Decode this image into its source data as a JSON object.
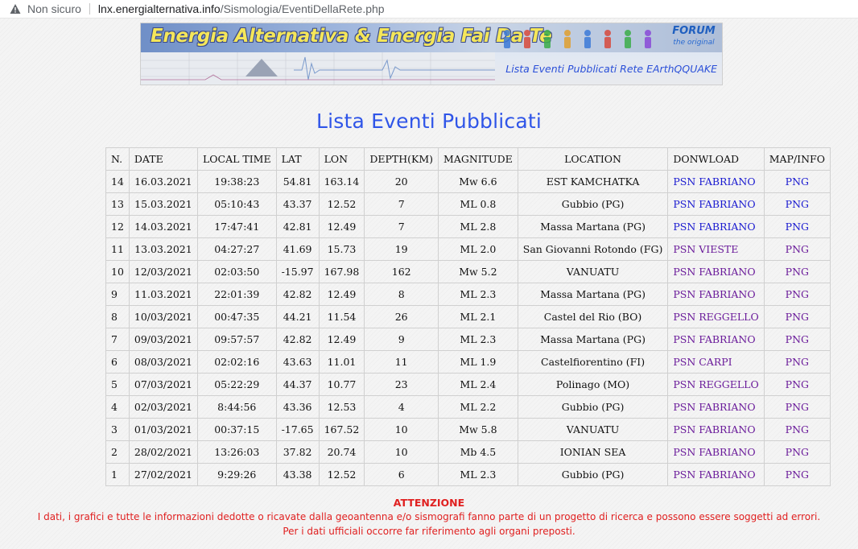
{
  "browser": {
    "security_label": "Non sicuro",
    "url_host": "lnx.energialternativa.info",
    "url_path": "/Sismologia/EventiDellaRete.php"
  },
  "banner": {
    "title": "Energia Alternativa & Energia Fai Da Te",
    "forum_label": "FORUM",
    "forum_sub": "the original",
    "subtitle": "Lista Eventi Pubblicati Rete EArthQQUAKE"
  },
  "page_title": "Lista Eventi Pubblicati",
  "table": {
    "headers": [
      "N.",
      "DATE",
      "LOCAL TIME",
      "LAT",
      "LON",
      "DEPTH(KM)",
      "MAGNITUDE",
      "LOCATION",
      "DONWLOAD",
      "MAP/INFO"
    ],
    "rows": [
      {
        "n": "14",
        "date": "16.03.2021",
        "time": "19:38:23",
        "lat": "54.81",
        "lon": "163.14",
        "depth": "20",
        "mag": "Mw 6.6",
        "location": "EST KAMCHATKA",
        "download": "PSN FABRIANO",
        "map": "PNG",
        "fresh": true
      },
      {
        "n": "13",
        "date": "15.03.2021",
        "time": "05:10:43",
        "lat": "43.37",
        "lon": "12.52",
        "depth": "7",
        "mag": "ML 0.8",
        "location": "Gubbio (PG)",
        "download": "PSN FABRIANO",
        "map": "PNG",
        "fresh": true
      },
      {
        "n": "12",
        "date": "14.03.2021",
        "time": "17:47:41",
        "lat": "42.81",
        "lon": "12.49",
        "depth": "7",
        "mag": "ML 2.8",
        "location": "Massa Martana (PG)",
        "download": "PSN FABRIANO",
        "map": "PNG",
        "fresh": true
      },
      {
        "n": "11",
        "date": "13.03.2021",
        "time": "04:27:27",
        "lat": "41.69",
        "lon": "15.73",
        "depth": "19",
        "mag": "ML 2.0",
        "location": "San Giovanni Rotondo (FG)",
        "download": "PSN VIESTE",
        "map": "PNG",
        "fresh": false
      },
      {
        "n": "10",
        "date": "12/03/2021",
        "time": "02:03:50",
        "lat": "-15.97",
        "lon": "167.98",
        "depth": "162",
        "mag": "Mw 5.2",
        "location": "VANUATU",
        "download": "PSN FABRIANO",
        "map": "PNG",
        "fresh": false
      },
      {
        "n": "9",
        "date": "11.03.2021",
        "time": "22:01:39",
        "lat": "42.82",
        "lon": "12.49",
        "depth": "8",
        "mag": "ML 2.3",
        "location": "Massa Martana (PG)",
        "download": "PSN FABRIANO",
        "map": "PNG",
        "fresh": false
      },
      {
        "n": "8",
        "date": "10/03/2021",
        "time": "00:47:35",
        "lat": "44.21",
        "lon": "11.54",
        "depth": "26",
        "mag": "ML 2.1",
        "location": "Castel del Rio (BO)",
        "download": "PSN REGGELLO",
        "map": "PNG",
        "fresh": false
      },
      {
        "n": "7",
        "date": "09/03/2021",
        "time": "09:57:57",
        "lat": "42.82",
        "lon": "12.49",
        "depth": "9",
        "mag": "ML 2.3",
        "location": "Massa Martana (PG)",
        "download": "PSN FABRIANO",
        "map": "PNG",
        "fresh": false
      },
      {
        "n": "6",
        "date": "08/03/2021",
        "time": "02:02:16",
        "lat": "43.63",
        "lon": "11.01",
        "depth": "11",
        "mag": "ML 1.9",
        "location": "Castelfiorentino (FI)",
        "download": "PSN CARPI",
        "map": "PNG",
        "fresh": false
      },
      {
        "n": "5",
        "date": "07/03/2021",
        "time": "05:22:29",
        "lat": "44.37",
        "lon": "10.77",
        "depth": "23",
        "mag": "ML 2.4",
        "location": "Polinago (MO)",
        "download": "PSN REGGELLO",
        "map": "PNG",
        "fresh": false
      },
      {
        "n": "4",
        "date": "02/03/2021",
        "time": "8:44:56",
        "lat": "43.36",
        "lon": "12.53",
        "depth": "4",
        "mag": "ML 2.2",
        "location": "Gubbio (PG)",
        "download": "PSN FABRIANO",
        "map": "PNG",
        "fresh": false
      },
      {
        "n": "3",
        "date": "01/03/2021",
        "time": "00:37:15",
        "lat": "-17.65",
        "lon": "167.52",
        "depth": "10",
        "mag": "Mw 5.8",
        "location": "VANUATU",
        "download": "PSN FABRIANO",
        "map": "PNG",
        "fresh": false
      },
      {
        "n": "2",
        "date": "28/02/2021",
        "time": "13:26:03",
        "lat": "37.82",
        "lon": "20.74",
        "depth": "10",
        "mag": "Mb 4.5",
        "location": "IONIAN SEA",
        "download": "PSN FABRIANO",
        "map": "PNG",
        "fresh": false
      },
      {
        "n": "1",
        "date": "27/02/2021",
        "time": "9:29:26",
        "lat": "43.38",
        "lon": "12.52",
        "depth": "6",
        "mag": "ML 2.3",
        "location": "Gubbio (PG)",
        "download": "PSN FABRIANO",
        "map": "PNG",
        "fresh": false
      }
    ]
  },
  "notice": {
    "title": "ATTENZIONE",
    "line1": "I dati, i grafici e tutte le informazioni dedotte o ricavate dalla geoantenna e/o sismografi fanno parte di un progetto di ricerca e possono essere soggetti ad errori.",
    "line2": "Per i dati ufficiali occorre far riferimento agli organi preposti."
  },
  "colors": {
    "title_blue": "#2f55e8",
    "link_visited": "#6a1b9a",
    "link_unvisited": "#1a1ad0",
    "warning_red": "#e02020"
  }
}
